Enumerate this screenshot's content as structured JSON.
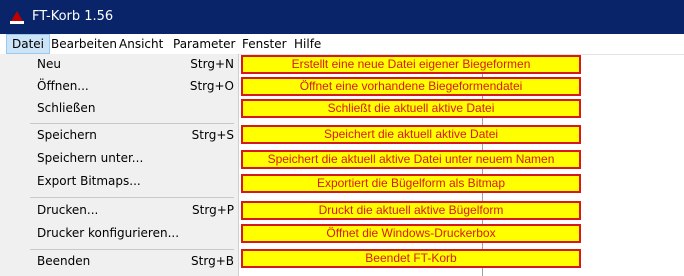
{
  "window": {
    "title": "FT-Korb 1.56",
    "icon": "ft-korb-app-icon"
  },
  "menubar": {
    "items": [
      {
        "label": "Datei",
        "active": true
      },
      {
        "label": "Bearbeiten"
      },
      {
        "label": "Ansicht"
      },
      {
        "label": "Parameter"
      },
      {
        "label": "Fenster"
      },
      {
        "label": "Hilfe"
      }
    ]
  },
  "file_menu": {
    "items": [
      {
        "label": "Neu",
        "shortcut": "Strg+N",
        "annotation": "Erstellt eine neue Datei eigener Biegeformen"
      },
      {
        "label": "Öffnen...",
        "shortcut": "Strg+O",
        "annotation": "Öffnet eine vorhandene Biegeformendatei"
      },
      {
        "label": "Schließen",
        "shortcut": "",
        "annotation": "Schließt die aktuell aktive Datei"
      },
      {
        "label": "Speichern",
        "shortcut": "Strg+S",
        "annotation": "Speichert die aktuell aktive Datei"
      },
      {
        "label": "Speichern unter...",
        "shortcut": "",
        "annotation": "Speichert die aktuell aktive Datei unter neuem Namen"
      },
      {
        "label": "Export Bitmaps...",
        "shortcut": "",
        "annotation": "Exportiert die Bügelform als Bitmap"
      },
      {
        "label": "Drucken...",
        "shortcut": "Strg+P",
        "annotation": "Druckt die aktuell aktive Bügelform"
      },
      {
        "label": "Drucker konfigurieren...",
        "shortcut": "",
        "annotation": "Öffnet die Windows-Druckerbox"
      },
      {
        "label": "Beenden",
        "shortcut": "Strg+B",
        "annotation": "Beendet FT-Korb"
      }
    ]
  },
  "colors": {
    "titlebar": "#0a246a",
    "annotation_bg": "#ffff00",
    "annotation_border": "#d81818",
    "annotation_text": "#d81818"
  }
}
